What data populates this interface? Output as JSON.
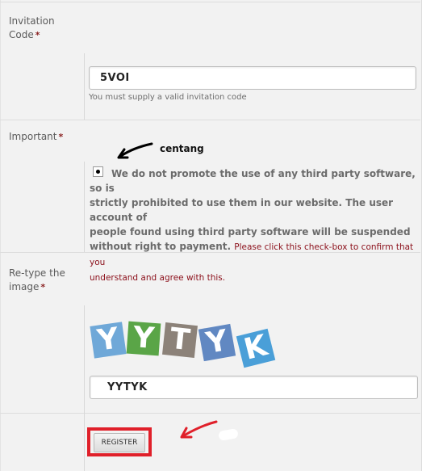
{
  "invitation": {
    "label_line1": "Invitation",
    "label_line2": "Code",
    "required": "*",
    "value": "5VOI",
    "hint": "You must supply a valid invitation code"
  },
  "important": {
    "label": "Important",
    "required": "*",
    "annotation": "centang",
    "line1": "We do not promote the use of any third party software, so is",
    "line2": "strictly prohibited to use them in our website. The user account of",
    "line3": "people found using third party software will be suspended",
    "line4_bold": "without right to payment.",
    "line4_confirm": "Please click this check-box to confirm that you",
    "line5_confirm": "understand and agree with this.",
    "checked": true
  },
  "captcha": {
    "label_line1": "Re-type the",
    "label_line2": "image",
    "required": "*",
    "image_letters": [
      "Y",
      "Y",
      "T",
      "Y",
      "K"
    ],
    "value": "YYTYK"
  },
  "register": {
    "label": "REGISTER"
  },
  "colors": {
    "required_star": "#8b2323",
    "confirm_text": "#8b0f1a",
    "highlight_box": "#e0202a",
    "arrow_black": "#000000",
    "arrow_red": "#e0202a",
    "tile_colors": [
      "#6fa8d8",
      "#5aa547",
      "#8c8279",
      "#6188c2",
      "#4a9fd8"
    ]
  }
}
